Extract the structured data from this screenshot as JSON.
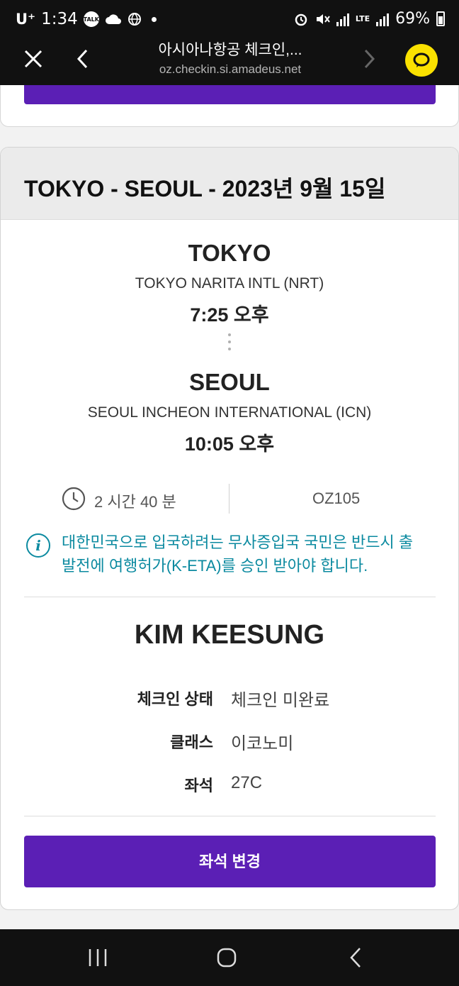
{
  "status_bar": {
    "carrier": "U⁺",
    "time": "1:34",
    "talk_icon_label": "TALK",
    "lte_label": "LTE",
    "battery": "69%"
  },
  "browser": {
    "title": "아시아나항공 체크인,...",
    "url": "oz.checkin.si.amadeus.net"
  },
  "flight": {
    "header": "TOKYO - SEOUL - 2023년 9월 15일",
    "origin": {
      "city": "TOKYO",
      "airport": "TOKYO NARITA INTL (NRT)",
      "time": "7:25 오후"
    },
    "destination": {
      "city": "SEOUL",
      "airport": "SEOUL INCHEON INTERNATIONAL (ICN)",
      "time": "10:05 오후"
    },
    "duration": "2 시간 40 분",
    "flight_number": "OZ105",
    "notice_line1": "대한민국으로 입국하려는 무사증입국 국민은 반드시 출",
    "notice_line2": "발전에 여행허가(K-ETA)를 승인 받아야 합니다."
  },
  "passenger": {
    "name": "KIM KEESUNG",
    "rows": [
      {
        "label": "체크인 상태",
        "value": "체크인 미완료"
      },
      {
        "label": "클래스",
        "value": "이코노미"
      },
      {
        "label": "좌석",
        "value": "27C"
      }
    ]
  },
  "actions": {
    "change_seat": "좌석 변경"
  },
  "colors": {
    "primary": "#5b1fb5",
    "notice": "#0b8aa0",
    "kakao_yellow": "#fae100"
  },
  "icons": [
    "close-icon",
    "back-arrow-icon",
    "forward-arrow-icon",
    "kakaotalk-icon",
    "clock-icon",
    "info-icon",
    "recent-apps-icon",
    "home-icon",
    "back-icon"
  ]
}
